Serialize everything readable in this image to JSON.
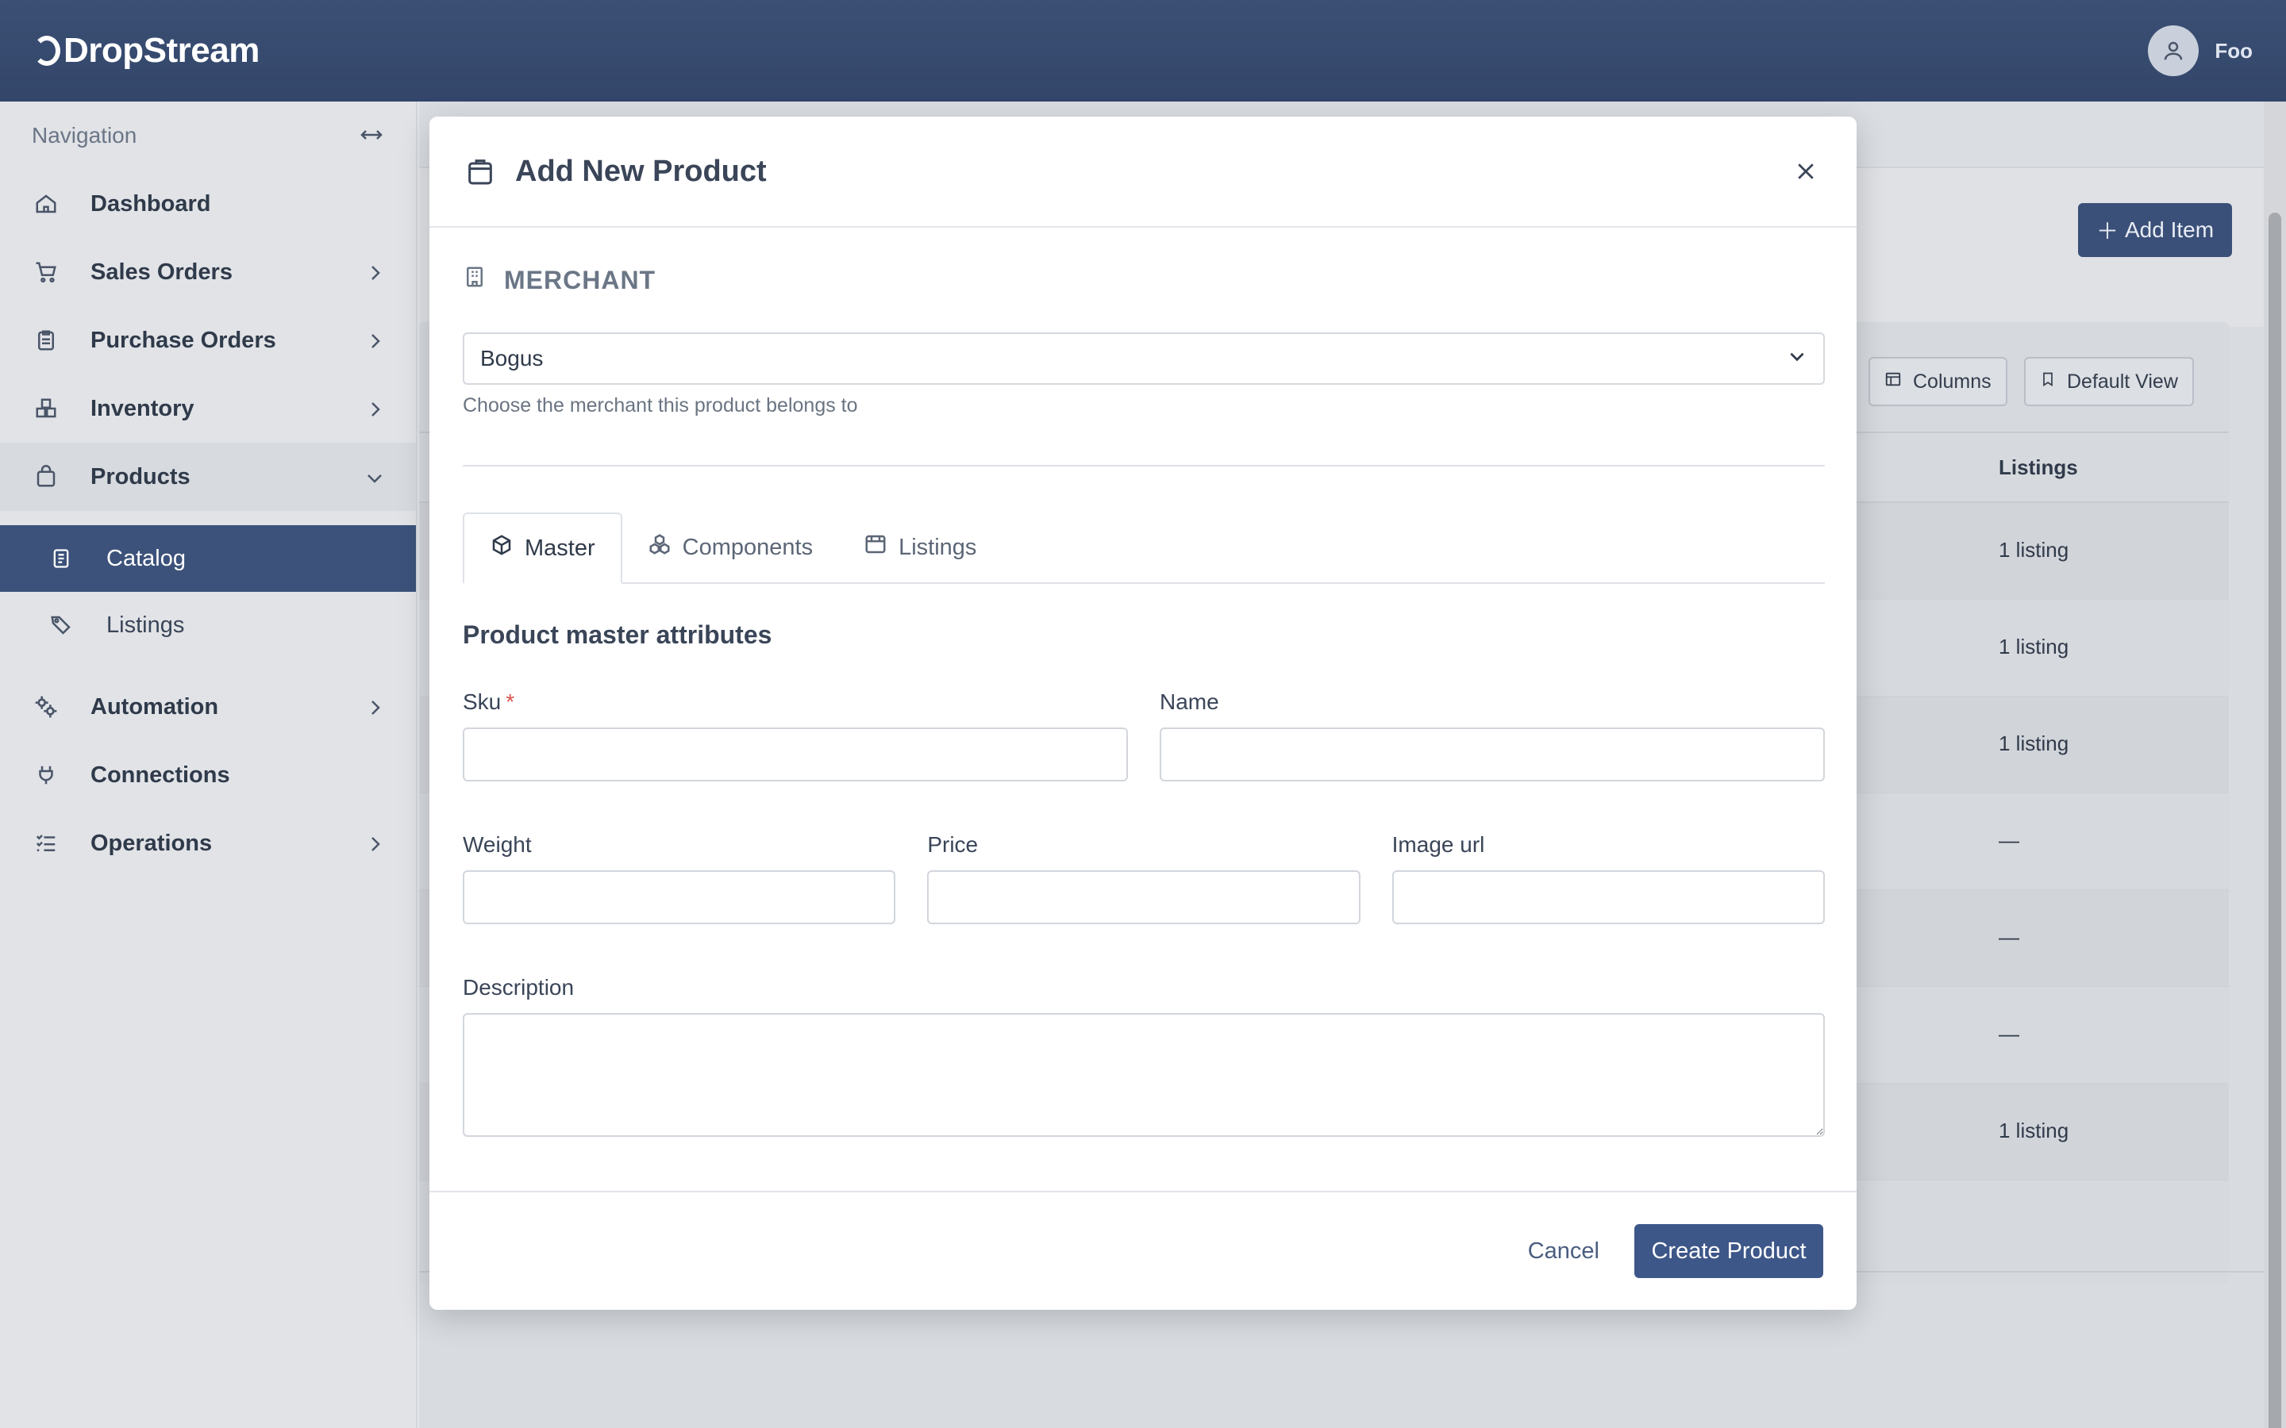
{
  "header": {
    "logo_text": "DropStream",
    "user_name": "Foo"
  },
  "sidebar": {
    "heading": "Navigation",
    "items": [
      {
        "label": "Dashboard",
        "icon": "home-icon"
      },
      {
        "label": "Sales Orders",
        "icon": "cart-icon"
      },
      {
        "label": "Purchase Orders",
        "icon": "clipboard-icon"
      },
      {
        "label": "Inventory",
        "icon": "boxes-icon"
      },
      {
        "label": "Products",
        "icon": "bag-icon"
      },
      {
        "label": "Catalog",
        "icon": "book-icon"
      },
      {
        "label": "Listings",
        "icon": "tags-icon"
      },
      {
        "label": "Automation",
        "icon": "gears-icon"
      },
      {
        "label": "Connections",
        "icon": "plug-icon"
      },
      {
        "label": "Operations",
        "icon": "list-check-icon"
      }
    ]
  },
  "background": {
    "add_item_label": "Add Item",
    "columns_label": "Columns",
    "default_view_label": "Default View",
    "listings_header": "Listings",
    "rows": [
      "1 listing",
      "1 listing",
      "1 listing",
      "—",
      "—",
      "—",
      "1 listing"
    ]
  },
  "modal": {
    "title": "Add New Product",
    "merchant_heading": "MERCHANT",
    "merchant_value": "Bogus",
    "merchant_help": "Choose the merchant this product belongs to",
    "tabs": [
      {
        "label": "Master",
        "icon": "cube-icon"
      },
      {
        "label": "Components",
        "icon": "components-icon"
      },
      {
        "label": "Listings",
        "icon": "storefront-icon"
      }
    ],
    "section_title": "Product master attributes",
    "fields": {
      "sku": {
        "label": "Sku",
        "required_mark": "*",
        "value": ""
      },
      "name": {
        "label": "Name",
        "value": ""
      },
      "weight": {
        "label": "Weight",
        "value": ""
      },
      "price": {
        "label": "Price",
        "value": ""
      },
      "image_url": {
        "label": "Image url",
        "value": ""
      },
      "description": {
        "label": "Description",
        "value": ""
      }
    },
    "cancel_label": "Cancel",
    "submit_label": "Create Product"
  }
}
